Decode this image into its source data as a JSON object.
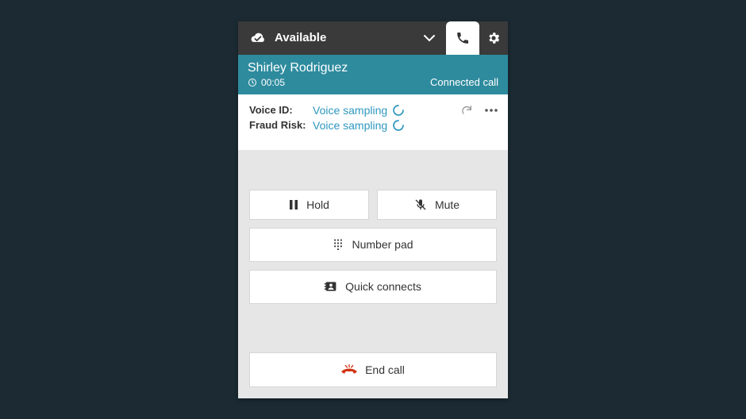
{
  "topbar": {
    "status": "Available"
  },
  "caller": {
    "name": "Shirley Rodriguez",
    "timer": "00:05",
    "status": "Connected call"
  },
  "voice": {
    "id_label": "Voice ID:",
    "id_value": "Voice sampling",
    "fraud_label": "Fraud Risk:",
    "fraud_value": "Voice sampling"
  },
  "buttons": {
    "hold": "Hold",
    "mute": "Mute",
    "numberpad": "Number pad",
    "quickconnects": "Quick connects",
    "endcall": "End call"
  }
}
